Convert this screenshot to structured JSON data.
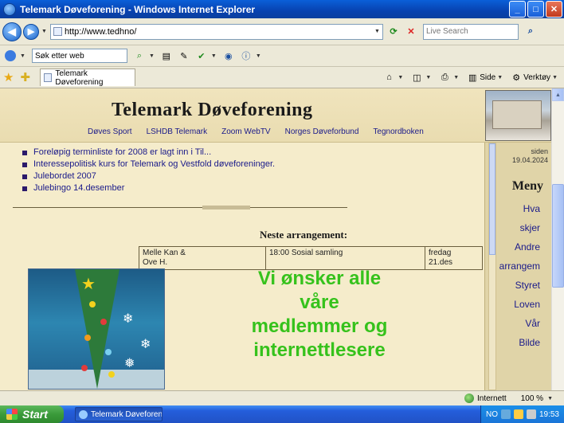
{
  "window": {
    "title": "Telemark Døveforening - Windows Internet Explorer"
  },
  "address_bar": {
    "url": "http://www.tedhno/",
    "search_placeholder": "Live Search"
  },
  "search_toolbar": {
    "input_value": "Søk etter web"
  },
  "command_bar": {
    "tab_label": "Telemark Døveforening",
    "commands": [
      {
        "label": "Side",
        "icon": "page-icon"
      },
      {
        "label": "Verktøy",
        "icon": "tools-icon"
      }
    ]
  },
  "site": {
    "title": "Telemark Døveforening",
    "nav": [
      "Døves Sport",
      "LSHDB Telemark",
      "Zoom WebTV",
      "Norges Døveforbund",
      "Tegnordboken"
    ]
  },
  "sidebar": {
    "date": "19.04.2024",
    "date_label": "siden",
    "menu_title": "Meny",
    "links": [
      "Hva",
      "skjer",
      "Andre",
      "arrangem",
      "Styret",
      "Loven",
      "Vår",
      "Bilde"
    ]
  },
  "news": [
    "Foreløpig terminliste for 2008 er lagt inn i Til...",
    "Interessepolitisk kurs for Telemark og Vestfold døveforeninger.",
    "Julebordet 2007",
    "Julebingo 14.desember"
  ],
  "events": {
    "title": "Neste arrangement:",
    "rows": [
      {
        "day": [
          "fredag",
          "21.des"
        ],
        "time": "18:00",
        "what": "Sosial samling",
        "where": [
          "Melle Kan &",
          "Ove H."
        ]
      }
    ]
  },
  "greeting": {
    "lines": [
      "Vi ønsker alle",
      "våre",
      "medlemmer og",
      "internettlesere"
    ]
  },
  "status_bar": {
    "zone": "Internett",
    "zoom": "100 %"
  },
  "taskbar": {
    "start_label": "Start",
    "task_label": "Telemark Døveforening",
    "tray_text": "NO",
    "clock": "19:53"
  }
}
